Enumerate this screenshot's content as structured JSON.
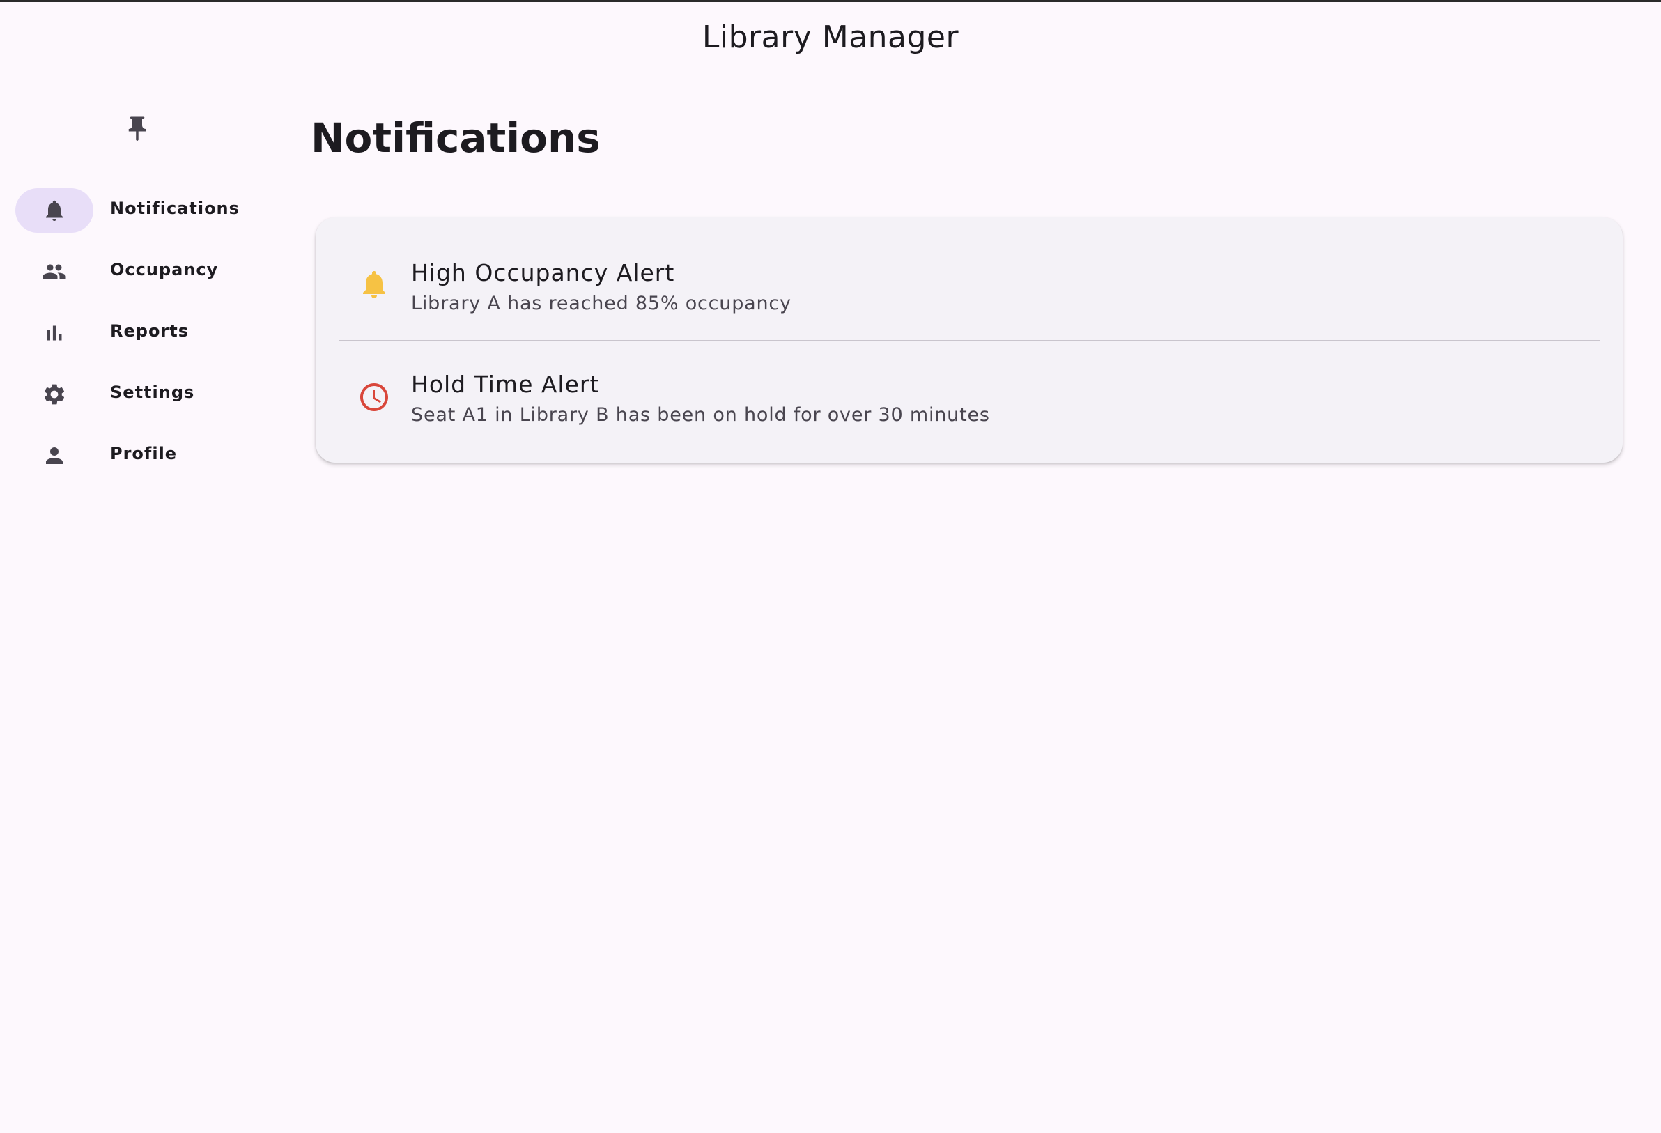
{
  "app": {
    "title": "Library Manager"
  },
  "rail": {
    "pin_icon": "push-pin-icon",
    "items": [
      {
        "label": "Notifications",
        "icon": "bell-icon",
        "active": true
      },
      {
        "label": "Occupancy",
        "icon": "people-icon",
        "active": false
      },
      {
        "label": "Reports",
        "icon": "bar-chart-icon",
        "active": false
      },
      {
        "label": "Settings",
        "icon": "gear-icon",
        "active": false
      },
      {
        "label": "Profile",
        "icon": "person-icon",
        "active": false
      }
    ]
  },
  "main": {
    "title": "Notifications",
    "notifications": [
      {
        "title": "High Occupancy Alert",
        "body": "Library A has reached 85% occupancy",
        "icon": "bell-icon",
        "icon_color": "#f6c244"
      },
      {
        "title": "Hold Time Alert",
        "body": "Seat A1 in Library B has been on hold for over 30 minutes",
        "icon": "clock-icon",
        "icon_color": "#d9473b"
      }
    ]
  },
  "colors": {
    "background": "#fdf8fd",
    "active_indicator": "#e8def8",
    "card": "#f4f2f7",
    "icon_dark": "#49454f"
  }
}
